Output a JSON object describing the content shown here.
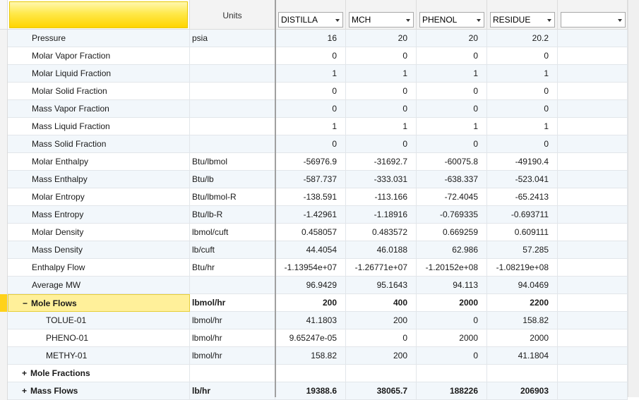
{
  "header": {
    "units_label": "Units",
    "columns": [
      "DISTILLA",
      "MCH",
      "PHENOL",
      "RESIDUE",
      ""
    ]
  },
  "rows": [
    {
      "name": "Pressure",
      "unit": "psia",
      "v": [
        "16",
        "20",
        "20",
        "20.2",
        ""
      ]
    },
    {
      "name": "Molar Vapor Fraction",
      "unit": "",
      "v": [
        "0",
        "0",
        "0",
        "0",
        ""
      ]
    },
    {
      "name": "Molar Liquid Fraction",
      "unit": "",
      "v": [
        "1",
        "1",
        "1",
        "1",
        ""
      ]
    },
    {
      "name": "Molar Solid Fraction",
      "unit": "",
      "v": [
        "0",
        "0",
        "0",
        "0",
        ""
      ]
    },
    {
      "name": "Mass Vapor Fraction",
      "unit": "",
      "v": [
        "0",
        "0",
        "0",
        "0",
        ""
      ]
    },
    {
      "name": "Mass Liquid Fraction",
      "unit": "",
      "v": [
        "1",
        "1",
        "1",
        "1",
        ""
      ]
    },
    {
      "name": "Mass Solid Fraction",
      "unit": "",
      "v": [
        "0",
        "0",
        "0",
        "0",
        ""
      ]
    },
    {
      "name": "Molar Enthalpy",
      "unit": "Btu/lbmol",
      "v": [
        "-56976.9",
        "-31692.7",
        "-60075.8",
        "-49190.4",
        ""
      ]
    },
    {
      "name": "Mass Enthalpy",
      "unit": "Btu/lb",
      "v": [
        "-587.737",
        "-333.031",
        "-638.337",
        "-523.041",
        ""
      ]
    },
    {
      "name": "Molar Entropy",
      "unit": "Btu/lbmol-R",
      "v": [
        "-138.591",
        "-113.166",
        "-72.4045",
        "-65.2413",
        ""
      ]
    },
    {
      "name": "Mass Entropy",
      "unit": "Btu/lb-R",
      "v": [
        "-1.42961",
        "-1.18916",
        "-0.769335",
        "-0.693711",
        ""
      ]
    },
    {
      "name": "Molar Density",
      "unit": "lbmol/cuft",
      "v": [
        "0.458057",
        "0.483572",
        "0.669259",
        "0.609111",
        ""
      ]
    },
    {
      "name": "Mass Density",
      "unit": "lb/cuft",
      "v": [
        "44.4054",
        "46.0188",
        "62.986",
        "57.285",
        ""
      ]
    },
    {
      "name": "Enthalpy Flow",
      "unit": "Btu/hr",
      "v": [
        "-1.13954e+07",
        "-1.26771e+07",
        "-1.20152e+08",
        "-1.08219e+08",
        ""
      ]
    },
    {
      "name": "Average MW",
      "unit": "",
      "v": [
        "96.9429",
        "95.1643",
        "94.113",
        "94.0469",
        ""
      ]
    },
    {
      "name": "Mole Flows",
      "unit": "lbmol/hr",
      "v": [
        "200",
        "400",
        "2000",
        "2200",
        ""
      ],
      "toggle": "−"
    },
    {
      "name": "TOLUE-01",
      "unit": "lbmol/hr",
      "v": [
        "41.1803",
        "200",
        "0",
        "158.82",
        ""
      ]
    },
    {
      "name": "PHENO-01",
      "unit": "lbmol/hr",
      "v": [
        "9.65247e-05",
        "0",
        "2000",
        "2000",
        ""
      ]
    },
    {
      "name": "METHY-01",
      "unit": "lbmol/hr",
      "v": [
        "158.82",
        "200",
        "0",
        "41.1804",
        ""
      ]
    },
    {
      "name": "Mole Fractions",
      "unit": "",
      "v": [
        "",
        "",
        "",
        "",
        ""
      ],
      "toggle": "+"
    },
    {
      "name": "Mass Flows",
      "unit": "lb/hr",
      "v": [
        "19388.6",
        "38065.7",
        "188226",
        "206903",
        ""
      ],
      "toggle": "+"
    }
  ]
}
